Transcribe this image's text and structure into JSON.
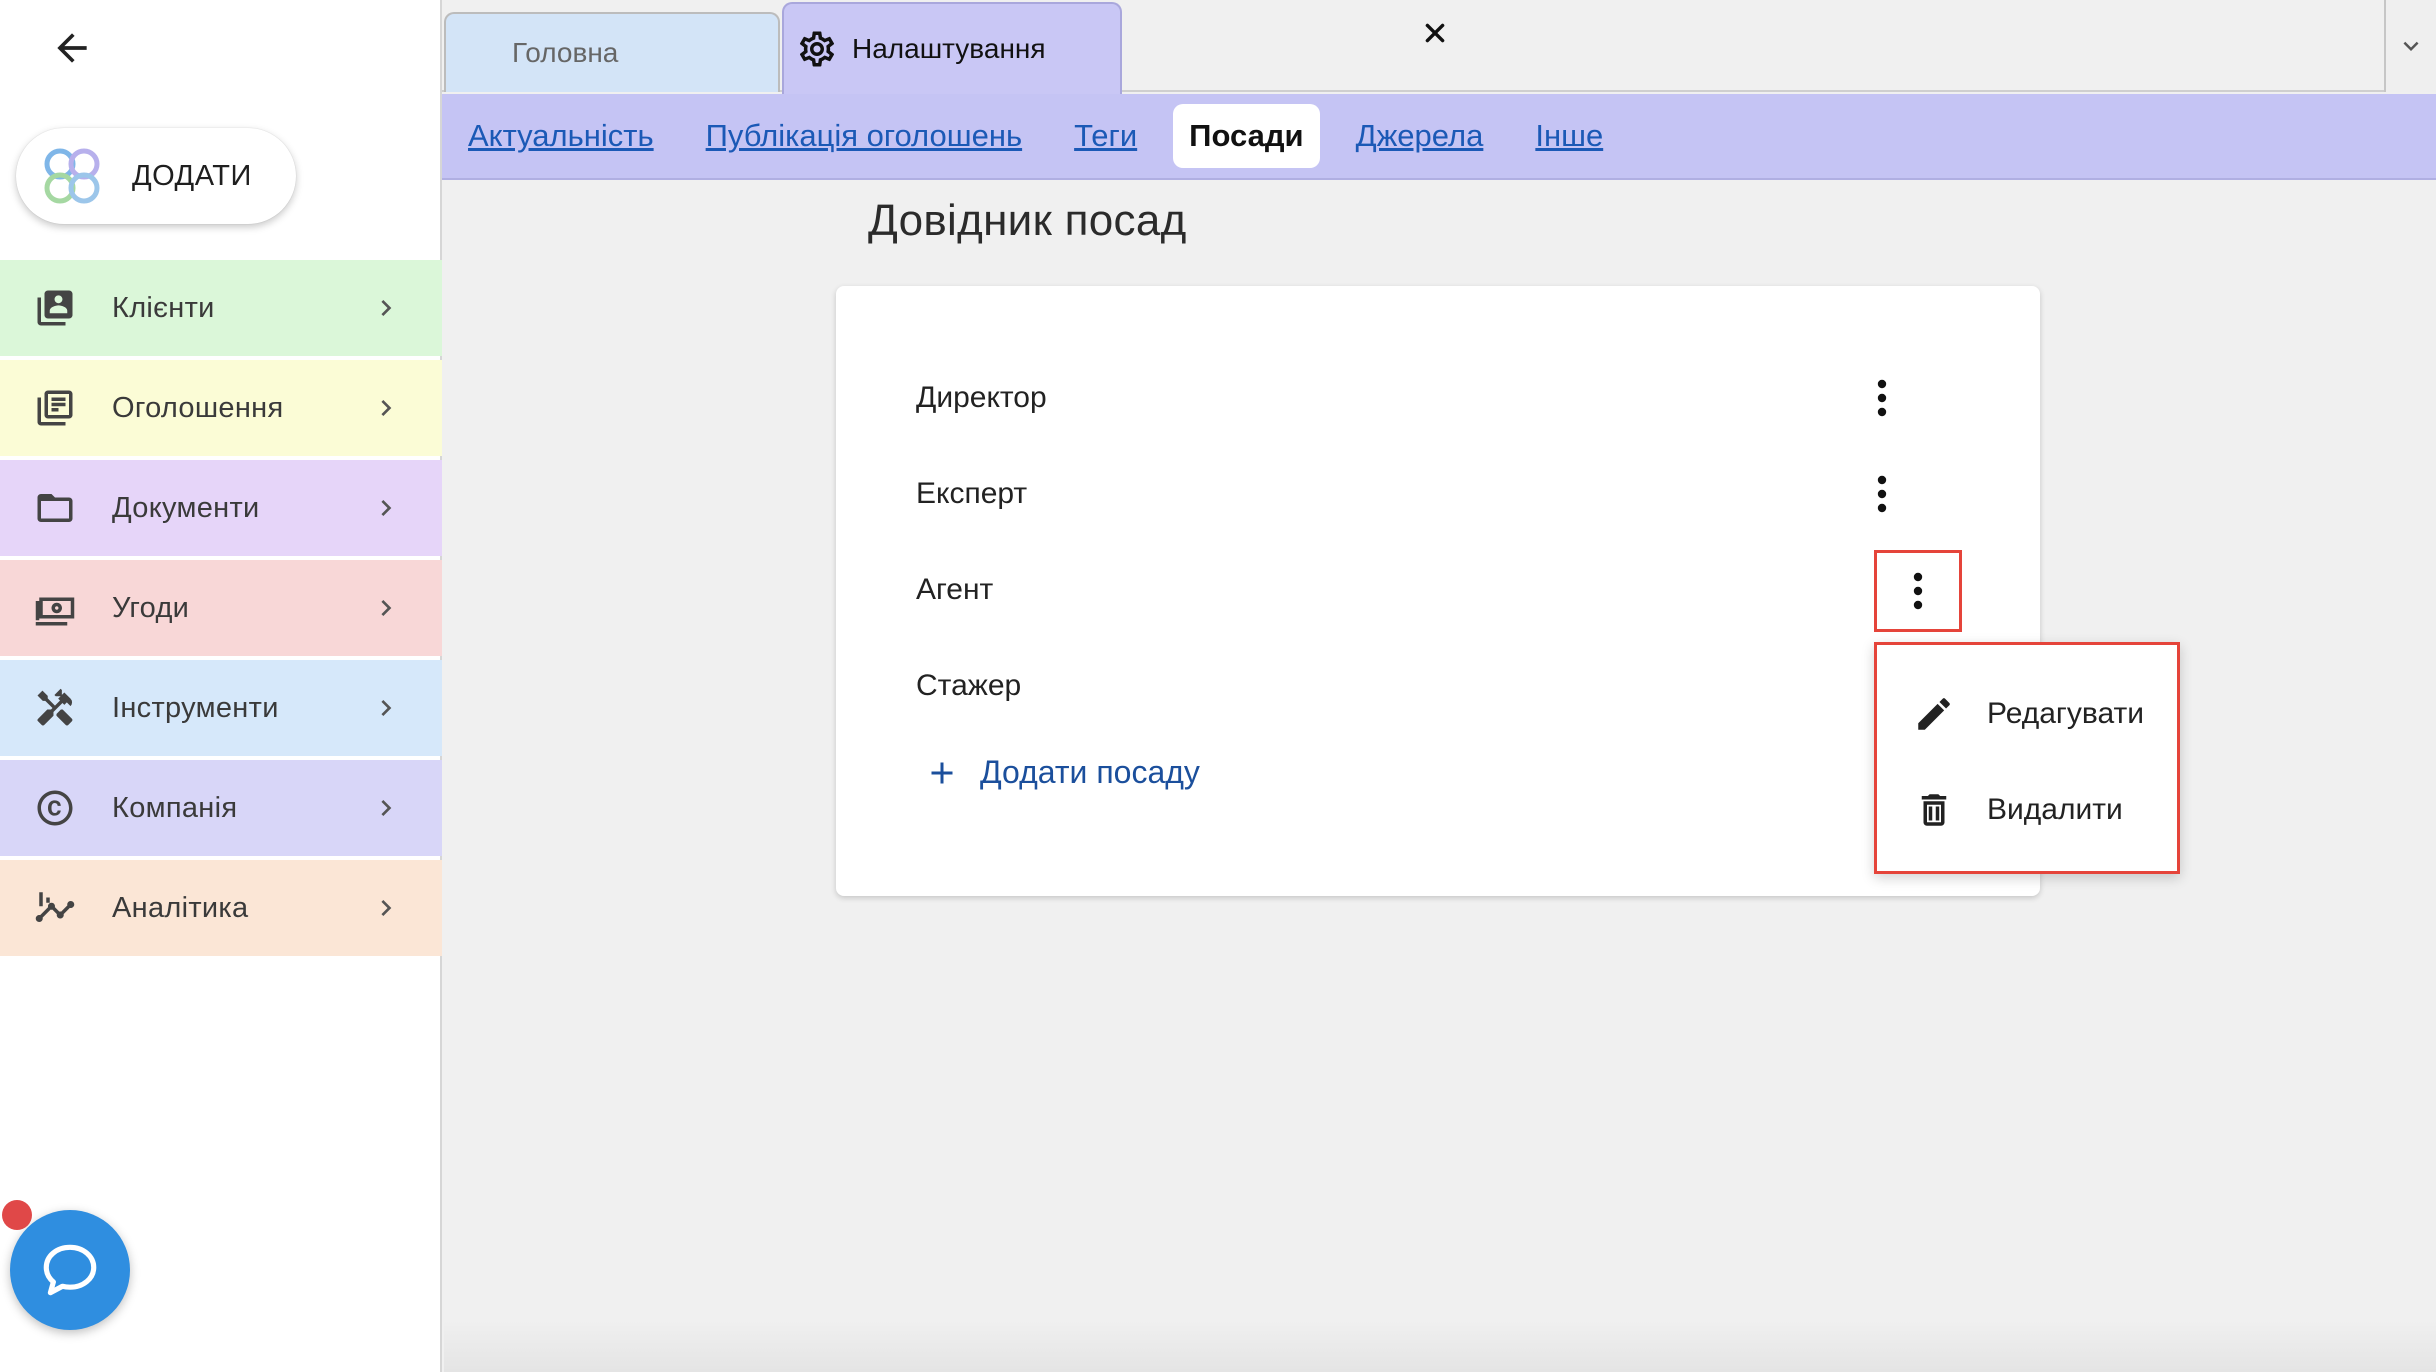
{
  "sidebar": {
    "add_label": "ДОДАТИ",
    "items": [
      {
        "label": "Клієнти",
        "icon": "contacts-icon",
        "bg": "#dbf7d9"
      },
      {
        "label": "Оголошення",
        "icon": "listings-icon",
        "bg": "#fbfcd6"
      },
      {
        "label": "Документи",
        "icon": "folder-icon",
        "bg": "#e6d5f9"
      },
      {
        "label": "Угоди",
        "icon": "money-icon",
        "bg": "#f8d7d7"
      },
      {
        "label": "Інструменти",
        "icon": "tools-icon",
        "bg": "#d6e8fa"
      },
      {
        "label": "Компанія",
        "icon": "copyright-icon",
        "bg": "#d8d6f8"
      },
      {
        "label": "Аналітика",
        "icon": "analytics-icon",
        "bg": "#fbe6d6"
      }
    ]
  },
  "tabs": {
    "home": "Головна",
    "settings": "Налаштування"
  },
  "subnav": {
    "items": [
      "Актуальність",
      "Публікація оголошень",
      "Теги",
      "Посади",
      "Джерела",
      "Інше"
    ],
    "active": "Посади"
  },
  "main": {
    "title": "Довідник посад",
    "positions": [
      "Директор",
      "Експерт",
      "Агент",
      "Стажер"
    ],
    "add_label": "Додати посаду"
  },
  "menu": {
    "edit": "Редагувати",
    "delete": "Видалити"
  },
  "colors": {
    "accent_link": "#1b59b6",
    "highlight": "#e5443a",
    "subnav_bg": "#c5c4f4",
    "chat": "#2f8ee0"
  }
}
